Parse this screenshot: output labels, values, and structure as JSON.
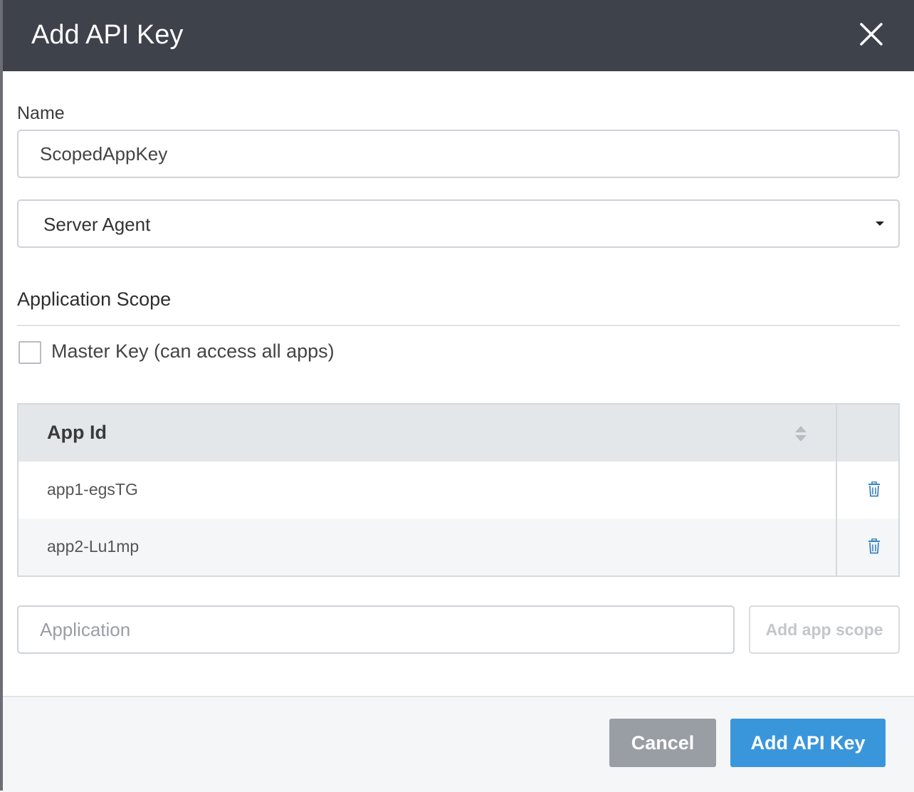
{
  "modal": {
    "title": "Add API Key",
    "close_icon": "close-icon"
  },
  "form": {
    "name_label": "Name",
    "name_value": "ScopedAppKey",
    "key_type_selected": "Server Agent",
    "scope_title": "Application Scope",
    "master_key_label": "Master Key (can access all apps)",
    "master_key_checked": false
  },
  "table": {
    "header": "App Id",
    "rows": [
      {
        "app_id": "app1-egsTG"
      },
      {
        "app_id": "app2-Lu1mp"
      }
    ],
    "row_icon": "trash-icon",
    "sort_icon": "sort-icon"
  },
  "add_scope": {
    "placeholder": "Application",
    "button_label": "Add app scope"
  },
  "footer": {
    "cancel_label": "Cancel",
    "submit_label": "Add API Key"
  },
  "colors": {
    "header_bg": "#3e424b",
    "primary": "#3a96db",
    "cancel": "#999ea5"
  }
}
